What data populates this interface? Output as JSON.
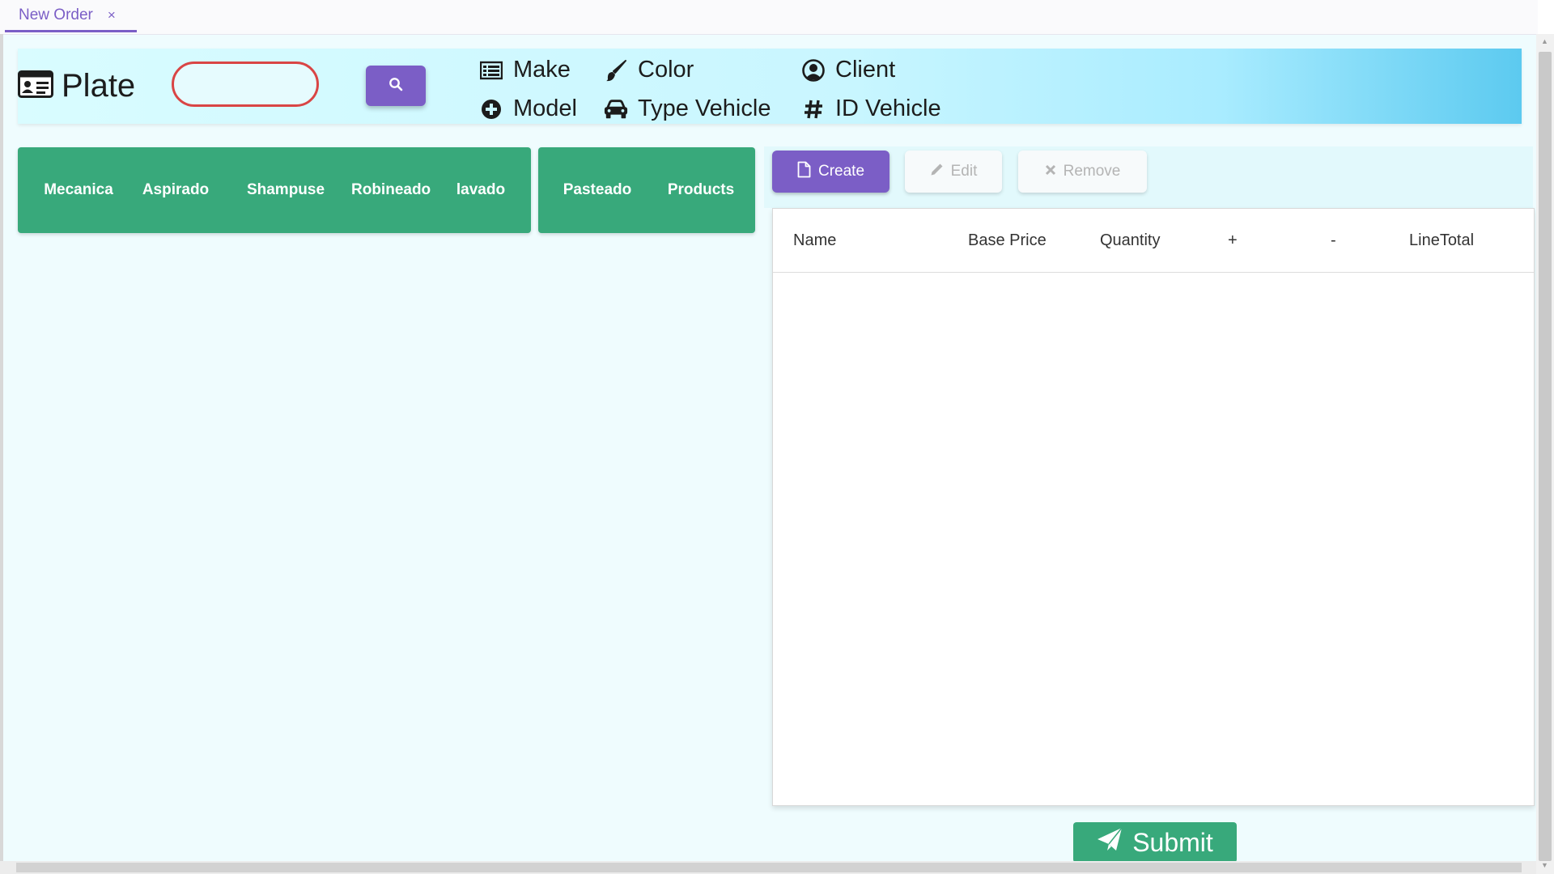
{
  "tab": {
    "label": "New Order",
    "close": "×"
  },
  "header": {
    "plate_label": "Plate",
    "plate_input": {
      "value": "",
      "placeholder": ""
    },
    "fields": {
      "make": "Make",
      "model": "Model",
      "color": "Color",
      "type_vehicle": "Type Vehicle",
      "client": "Client",
      "id_vehicle": "ID Vehicle"
    }
  },
  "categories": {
    "group1": [
      "Mecanica",
      "Aspirado",
      "Shampuse",
      "Robineado",
      "lavado"
    ],
    "group2": [
      "Pasteado",
      "Products"
    ]
  },
  "toolbar": {
    "create": "Create",
    "edit": "Edit",
    "remove": "Remove"
  },
  "table": {
    "columns": [
      "Name",
      "Base Price",
      "Quantity",
      "+",
      "-",
      "LineTotal"
    ],
    "rows": []
  },
  "submit_label": "Submit",
  "colors": {
    "accent_purple": "#7b5ec6",
    "category_green": "#38a97b",
    "plate_border_red": "#d94545",
    "header_gradient_end": "#5ccaf0",
    "background": "#effcfe"
  }
}
